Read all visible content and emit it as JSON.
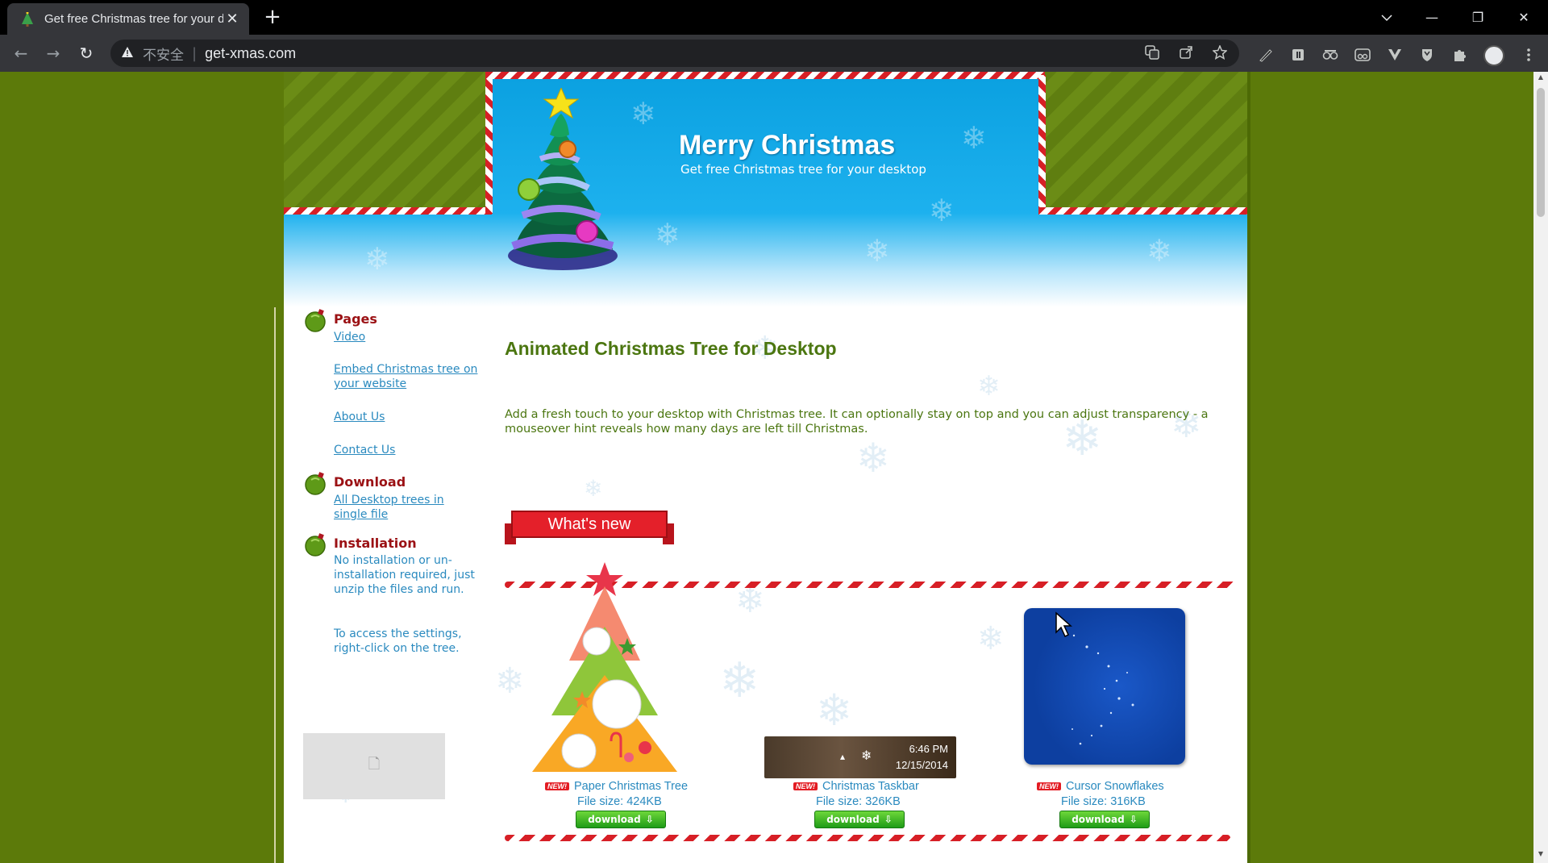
{
  "browser": {
    "tab_title": "Get free Christmas tree for your desktop",
    "tab_close": "✕",
    "new_tab": "+",
    "insecure_label": "不安全",
    "url": "get-xmas.com",
    "window_controls": {
      "minimize": "—",
      "restore": "❐",
      "close": "✕"
    },
    "nav": {
      "back": "←",
      "forward": "→",
      "reload": "↻"
    }
  },
  "header": {
    "title": "Merry Christmas",
    "tagline": "Get free Christmas tree for your desktop"
  },
  "sidebar": {
    "pages_heading": "Pages",
    "pages_links": [
      "Video",
      "Embed Christmas tree on your website",
      "About Us",
      "Contact Us"
    ],
    "download_heading": "Download",
    "download_link": "All Desktop trees in single file",
    "installation_heading": "Installation",
    "installation_text": "No installation or un-installation required, just unzip the files and run.",
    "settings_text": "To access the settings, right-click on the tree."
  },
  "main": {
    "title": "Animated Christmas Tree for Desktop",
    "description": "Add a fresh touch to your desktop with Christmas tree. It can optionally stay on top and you can adjust transparency - a mouseover hint reveals how many days are left till Christmas.",
    "whats_new_label": "What's new",
    "items": [
      {
        "badge": "NEW!",
        "name": "Paper Christmas Tree",
        "size": "File size: 424KB",
        "button": "download"
      },
      {
        "badge": "NEW!",
        "name": "Christmas Taskbar",
        "size": "File size: 326KB",
        "button": "download"
      },
      {
        "badge": "NEW!",
        "name": "Cursor Snowflakes",
        "size": "File size: 316KB",
        "button": "download"
      }
    ],
    "taskbar_time": "6:46 PM",
    "taskbar_date": "12/15/2014"
  }
}
